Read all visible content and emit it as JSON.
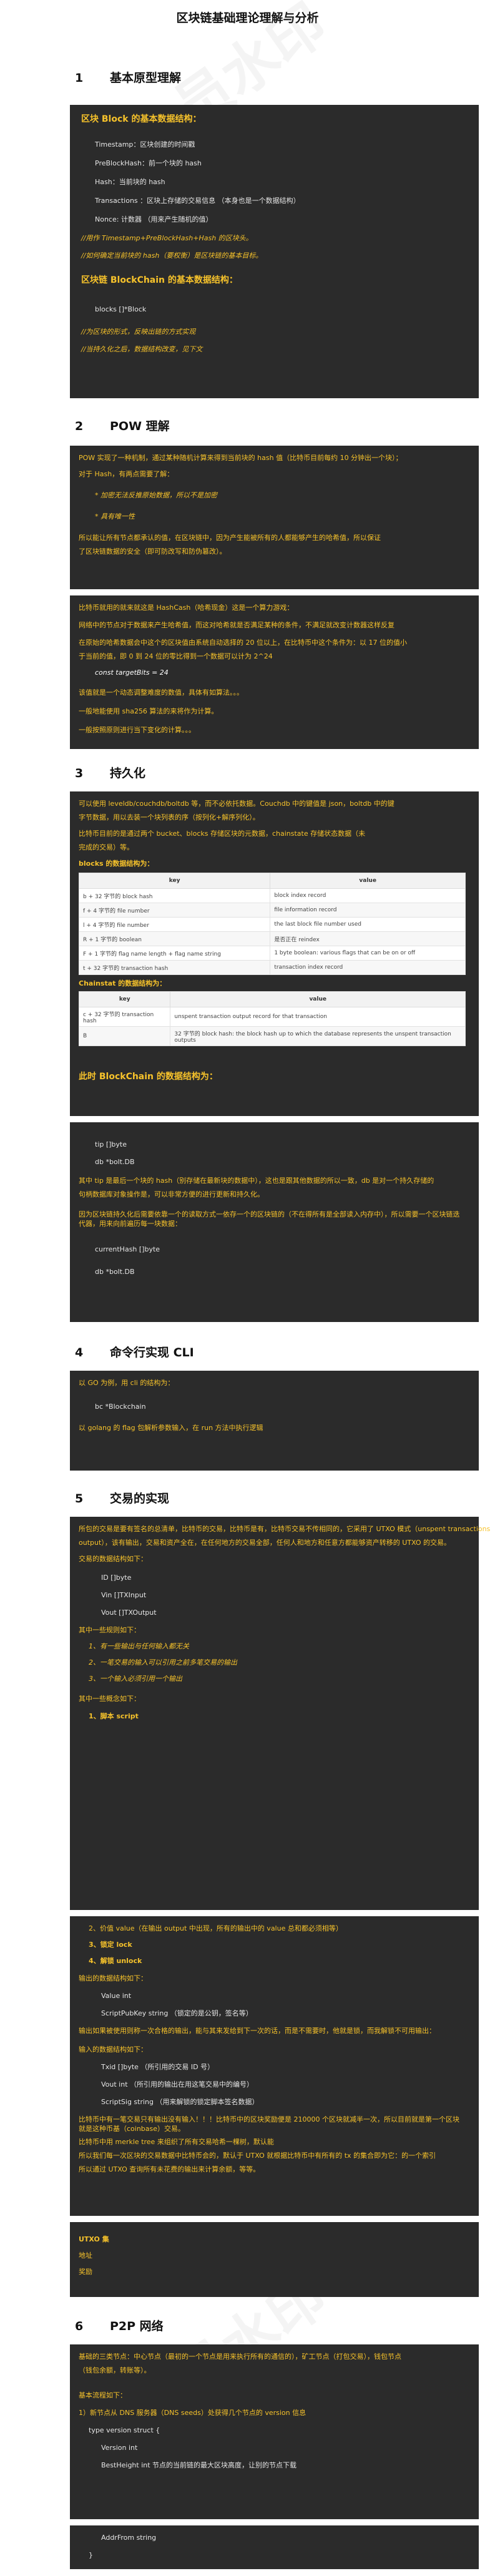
{
  "title": "区块链基础理论理解与分析",
  "watermark": "会员水印",
  "s1": {
    "num": "1",
    "title": "基本原型理解",
    "block_head": "区块 Block 的基本数据结构：",
    "block_fields": [
      "Timestamp：区块创建的时间戳",
      "PreBlockHash：前一个块的 hash",
      "Hash：当前块的 hash",
      "Transactions ：区块上存储的交易信息 （本身也是一个数据结构）",
      "Nonce: 计数器 （用来产生随机的值）"
    ],
    "notes1": [
      "//用作 Timestamp+PreBlockHash+Hash 的区块头。",
      "//如何确定当前块的 hash（要权衡）是区块链的基本目标。"
    ],
    "chain_head": "区块链 BlockChain 的基本数据结构：",
    "chain_fields": [
      "blocks []*Block"
    ],
    "notes2": [
      "//为区块的形式，反映出链的方式实现",
      "//当持久化之后，数据结构改变，见下文"
    ]
  },
  "s2": {
    "num": "2",
    "title": "POW 理解",
    "p1": [
      "POW 实现了一种机制，通过某种随机计算来得到当前块的 hash 值（比特币目前每约 10 分钟出一个块）；",
      "对于 Hash，有两点需要了解：",
      "* 加密无法反推原始数据，所以不是加密",
      "* 具有唯一性",
      "所以能让所有节点都承认的值，在区块链中，因为产生能被所有的人都能够产生的哈希值，所以保证",
      "了区块链数据的安全（即可防改写和防伪篡改）。"
    ],
    "p2": [
      "比特币就用的就来就这是 HashCash（哈希现金）这是一个算力游戏：",
      "网络中的节点对于数据来产生哈希值，而这对哈希就是否满足某种的条件，不满足就改变计数器这样反复",
      "在原始的哈希数据会中这个的区块值由系统自动选择的 20 位以上，在比特币中这个条件为：以 17 位的值小",
      "于当前的值，即 0 到 24 位的零比得到一个数据可以计为 2^24",
      "const targetBits = 24",
      "该值就是一个动态调整难度的数值，具体有如算法。。。",
      "一般地能使用 sha256 算法的来将作为计算。",
      "一般按照原则进行当下变化的计算。。。"
    ]
  },
  "s3": {
    "num": "3",
    "title": "持久化",
    "p1": [
      "可以使用 leveldb/couchdb/boltdb 等，而不必依托数据。Couchdb 中的键值是 json，boltdb 中的键",
      "字节数据，用以去装一个块列表的序（按列化+解序列化）。",
      "比特币目前的是通过两个 bucket、blocks 存储区块的元数据，chainstate 存储状态数据（未",
      "完成的交易）等。",
      "blocks 的数据结构为："
    ],
    "tbl1_headers": [
      "key",
      "value"
    ],
    "tbl1_rows": [
      [
        "b + 32 字节的 block hash",
        "block index record"
      ],
      [
        "f + 4 字节的 file number",
        "file information record"
      ],
      [
        "l + 4 字节的 file number",
        "the last block file number used"
      ],
      [
        "R + 1 字节的 boolean",
        "是否正在 reindex"
      ],
      [
        "F + 1 字节的 flag name length + flag name string",
        "1 byte boolean: various flags that can be on or off"
      ],
      [
        "t + 32 字节的 transaction hash",
        "transaction index record"
      ]
    ],
    "chainstate_head": "Chainstat 的数据结构为：",
    "tbl2_headers": [
      "key",
      "value"
    ],
    "tbl2_rows": [
      [
        "c + 32 字节的 transaction hash",
        "unspent transaction output record for that transaction"
      ],
      [
        "B",
        "32 字节的 block hash: the block hash up to which the database represents the unspent transaction outputs"
      ]
    ],
    "chain_head": "此时 BlockChain 的数据结构为：",
    "code": [
      "tip []byte",
      "db *bolt.DB"
    ],
    "p2": [
      "其中 tip 是最后一个块的 hash（别存储在最新块的数据中），这也是跟其他数据的所以一致，db 是对一个持久存储的",
      "句柄数据库对象操作是，可以非常方便的进行更新和持久化。",
      "因为区块链持久化后需要依靠一个的读取方式一依存一个的区块链的（不在得所有是全部读入内存中），所以需要一个区块链迭代器，用来向前遍历每一块数据："
    ],
    "code2": [
      "currentHash []byte",
      "db *bolt.DB"
    ]
  },
  "s4": {
    "num": "4",
    "title": "命令行实现 CLI",
    "lines": [
      "以 GO 为例，用 cli 的结构为：",
      "bc *Blockchain",
      "以 golang 的 flag 包解析参数输入，在 run 方法中执行逻辑"
    ]
  },
  "s5": {
    "num": "5",
    "title": "交易的实现",
    "p1": [
      "所包的交易是要有签名的总清单，比特币的交易，比特币是有，比特币交易不传相同的，它采用了 UTXO 模式（unspent transactions",
      "output），该有输出，交易和资产全在，在任何地方的交易全部，任何人和地方和任意方都能够资产转移的 UTXO 的交易。",
      "交易的数据结构如下："
    ],
    "code1": [
      "ID []byte",
      "Vin []TXInput",
      "Vout []TXOutput"
    ],
    "notes": [
      "其中一些规则如下：",
      "1、有一些输出与任何输入都无关",
      "2、一笔交易的输入可以引用之前多笔交易的输出",
      "3、一个输入必须引用一个输出"
    ],
    "head2": "其中一些概念如下：",
    "l1": "1、脚本 script",
    "l2": [
      "2、价值 value（在输出 output 中出现，所有的输出中的 value 总和都必须相等）",
      "3、锁定 lock",
      "4、解锁 unlock"
    ],
    "out_head": "输出的数据结构如下：",
    "code2": [
      "Value int",
      "ScriptPubKey string （锁定的是公钥，签名等）"
    ],
    "in_head": "输出如果被使用则称一次合格的输出，能与其来发给到下一次的话，而是不需要时，他就是锁，而我解锁不可用输出：",
    "in_head2": "输入的数据结构如下：",
    "code3": [
      "Txid []byte （所引用的交易 ID 号）",
      "Vout int （所引用的输出在用这笔交易中的编号）",
      "ScriptSig string （用来解锁的锁定脚本签名数据）"
    ],
    "p2": [
      "比特币中有一笔交易只有输出没有输入！！！比特币中的区块奖励便是 210000 个区块就减半一次，所以目前就是第一个区块就是这种币基（coinbase）交易。",
      "比特币中用 merkle tree 来组织了所有交易哈希一棵树，默认能",
      "所以我们每一次区块的交易数据中比特币会的，默认于 UTXO 就根据比特币中有所有的 tx 的集合即为它：的一个索引",
      "所以通过 UTXO 查询所有未花费的输出来计算余额，等等。"
    ],
    "tail": [
      "UTXO 集",
      "地址",
      "奖励"
    ]
  },
  "s6": {
    "num": "6",
    "title": "P2P 网络",
    "p1": [
      "基础的三类节点：中心节点（最初的一个节点是用来执行所有的通信的），矿工节点（打包交易），钱包节点",
      "（钱包余额，转账等）。"
    ],
    "head": "基本流程如下：",
    "l1": "1）新节点从 DNS 服务器（DNS seeds）处获得几个节点的 version 信息",
    "code": [
      "type version struct {",
      "Version int",
      "BestHeight int 节点的当前链的最大区块高度，让别的节点下载"
    ],
    "code2": [
      "AddrFrom string",
      "}"
    ]
  }
}
